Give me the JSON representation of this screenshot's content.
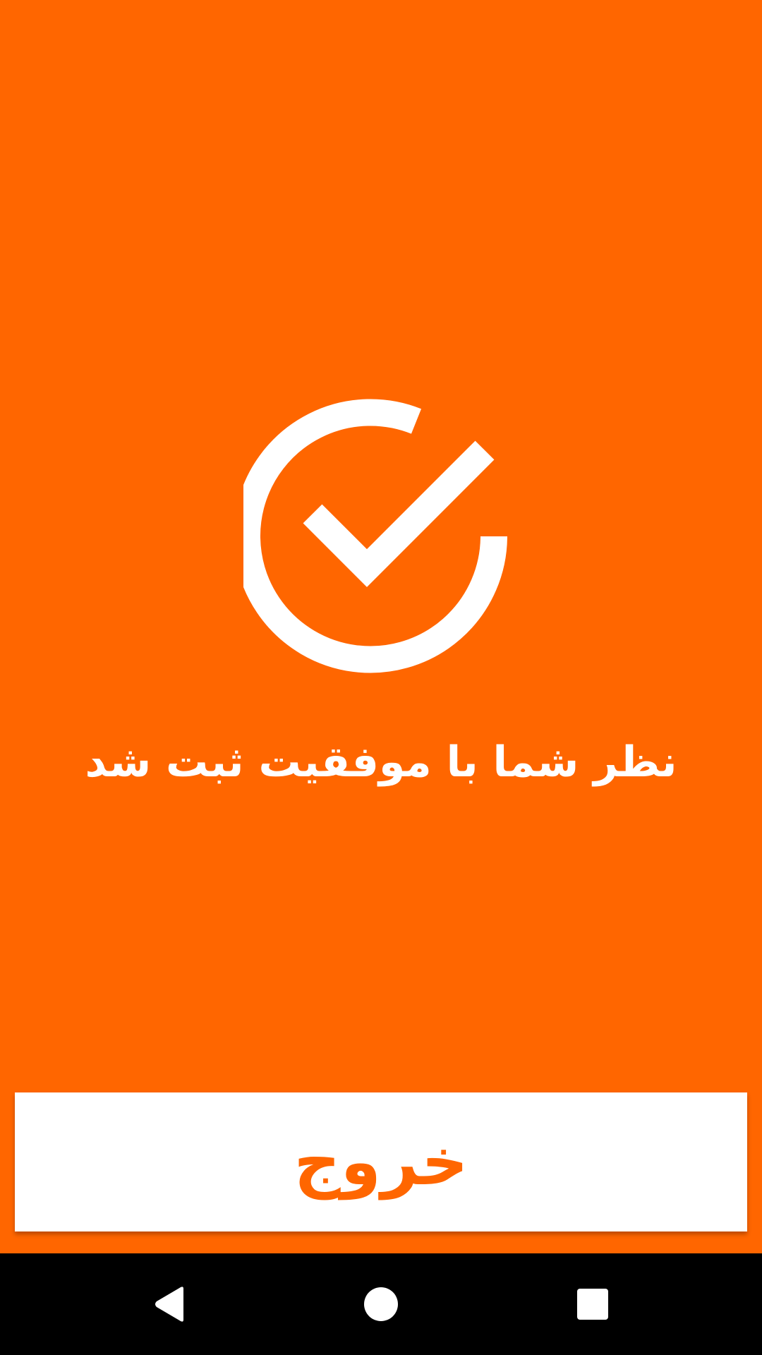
{
  "colors": {
    "background": "#ff6600",
    "foreground": "#ffffff",
    "button_text": "#ff6600",
    "nav_bar": "#000000"
  },
  "icons": {
    "success": "check-circle-icon",
    "back": "back-triangle-icon",
    "home": "home-circle-icon",
    "recents": "recents-square-icon"
  },
  "message": "نظر شما با موفقیت ثبت شد",
  "exit_button": {
    "label": "خروج"
  }
}
